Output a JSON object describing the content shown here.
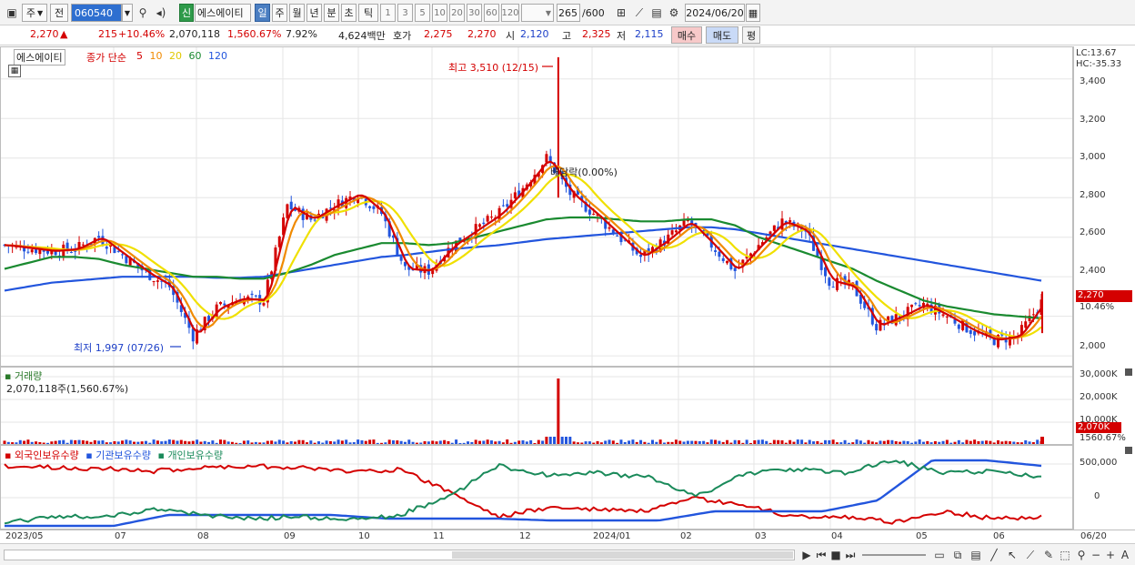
{
  "toolbar": {
    "market_tab": "주",
    "prev_tab": "전",
    "code": "060540",
    "new_badge": "신",
    "stock_name": "에스에이티",
    "period_tabs": [
      "일",
      "주",
      "월",
      "년",
      "분",
      "초",
      "틱"
    ],
    "active_period": "일",
    "intervals": [
      "1",
      "3",
      "5",
      "10",
      "20",
      "30",
      "60",
      "120"
    ],
    "count": "265",
    "count_max": "/600",
    "date": "2024/06/20"
  },
  "quote": {
    "price": "2,270",
    "change_arrow": "▲",
    "change": "215",
    "change_pct": "+10.46%",
    "volume": "2,070,118",
    "volume_ratio": "1,560.67%",
    "turnover": "7.92%",
    "amount": "4,624백만",
    "bid_label": "호가",
    "ask": "2,275",
    "bid": "2,270",
    "open_label": "시",
    "open": "2,120",
    "high_label": "고",
    "high": "2,325",
    "low_label": "저",
    "low": "2,115",
    "buy_button": "매수",
    "sell_button": "매도",
    "eval_button": "평"
  },
  "price_panel": {
    "stock_label": "에스에이티",
    "ma_label": "종가 단순",
    "ma_periods": [
      "5",
      "10",
      "20",
      "60",
      "120"
    ],
    "ma_colors": [
      "#d40000",
      "#f08a00",
      "#f0e000",
      "#1a8a30",
      "#2255dd"
    ],
    "high_annotation": "최고 3,510 (12/15)",
    "low_annotation": "최저 1,997 (07/26)",
    "dividend_annotation": "배당락(0.00%)",
    "lc": "LC:13.67",
    "hc": "HC:-35.33",
    "y_ticks": [
      "3,400",
      "3,200",
      "3,000",
      "2,800",
      "2,600",
      "2,400",
      "2,000"
    ],
    "current_price_tag": "2,270",
    "current_pct_tag": "10.46%"
  },
  "volume_panel": {
    "title": "거래량",
    "value_text": "2,070,118주(1,560.67%)",
    "y_ticks": [
      "30,000K",
      "20,000K",
      "10,000K"
    ],
    "current_tag": "2,070K",
    "pct_tag": "1560.67%"
  },
  "holding_panel": {
    "series_labels": [
      "외국인보유수량",
      "기관보유수량",
      "개인보유수량"
    ],
    "series_colors": [
      "#d40000",
      "#2255dd",
      "#1a8a5a"
    ],
    "y_ticks": [
      "500,000",
      "0"
    ]
  },
  "date_axis": [
    "2023/05",
    "07",
    "08",
    "09",
    "10",
    "11",
    "12",
    "2024/01",
    "02",
    "03",
    "04",
    "05",
    "06",
    "06/20"
  ],
  "chart_data": {
    "type": "line",
    "series": [
      {
        "name": "5",
        "values": [
          2560,
          2545,
          2530,
          2540,
          2600,
          2510,
          2420,
          2350,
          2100,
          2240,
          2290,
          2280,
          2760,
          2690,
          2760,
          2820,
          2720,
          2440,
          2430,
          2560,
          2640,
          2720,
          2850,
          3000,
          2820,
          2720,
          2610,
          2500,
          2580,
          2680,
          2560,
          2430,
          2560,
          2680,
          2630,
          2380,
          2350,
          2150,
          2200,
          2260,
          2200,
          2130,
          2080,
          2100,
          2270
        ]
      },
      {
        "name": "60",
        "values": [
          2440,
          2470,
          2500,
          2500,
          2490,
          2460,
          2440,
          2420,
          2400,
          2400,
          2390,
          2390,
          2420,
          2460,
          2510,
          2540,
          2570,
          2570,
          2560,
          2570,
          2600,
          2630,
          2660,
          2690,
          2700,
          2700,
          2690,
          2680,
          2680,
          2690,
          2690,
          2660,
          2600,
          2560,
          2520,
          2480,
          2440,
          2380,
          2330,
          2280,
          2250,
          2230,
          2210,
          2200,
          2190
        ]
      },
      {
        "name": "120",
        "values": [
          2330,
          2350,
          2370,
          2380,
          2390,
          2400,
          2400,
          2400,
          2400,
          2395,
          2395,
          2400,
          2420,
          2440,
          2460,
          2480,
          2500,
          2510,
          2525,
          2540,
          2550,
          2560,
          2575,
          2590,
          2600,
          2610,
          2620,
          2630,
          2640,
          2650,
          2650,
          2640,
          2620,
          2600,
          2580,
          2560,
          2540,
          2520,
          2500,
          2480,
          2460,
          2440,
          2420,
          2400,
          2380
        ]
      }
    ],
    "ylim": [
      1950,
      3560
    ]
  }
}
